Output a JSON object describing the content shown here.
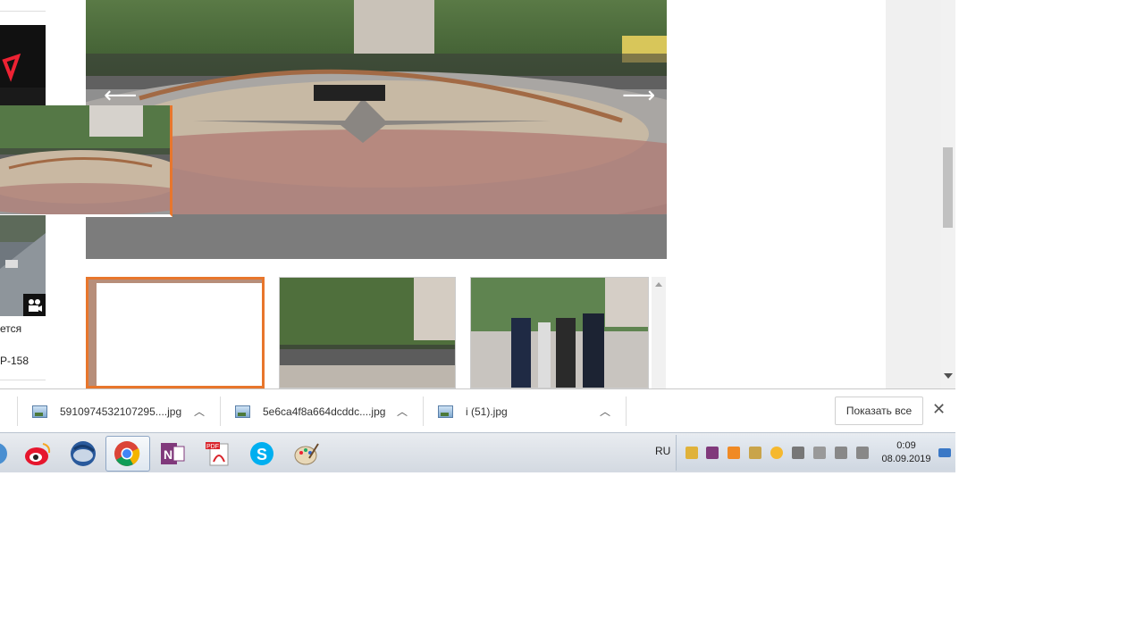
{
  "gallery": {
    "prev_arrow": "⟵",
    "next_arrow": "⟶"
  },
  "sidebar": {
    "caption_line1": "ется",
    "caption_line2": "Р-158"
  },
  "downloads": {
    "items": [
      {
        "name": "5910974532107295....jpg",
        "icon": "image-file-icon"
      },
      {
        "name": "5e6ca4f8a664dcddc....jpg",
        "icon": "image-file-icon"
      },
      {
        "name": "i (51).jpg",
        "icon": "image-file-icon"
      }
    ],
    "show_all": "Показать все",
    "close": "✕"
  },
  "taskbar": {
    "language": "RU",
    "time": "0:09",
    "date": "08.09.2019",
    "apps": [
      "app-icon",
      "weibo-icon",
      "thunderbird-icon",
      "chrome-icon",
      "onenote-icon",
      "pdf-icon",
      "skype-icon",
      "paint-icon"
    ]
  }
}
